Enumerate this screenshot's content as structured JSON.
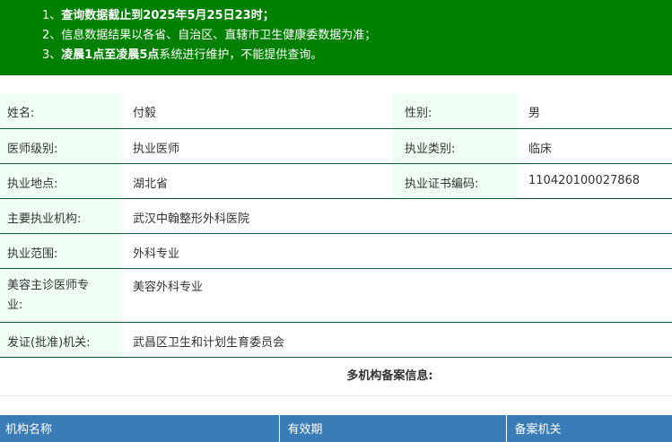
{
  "notice": {
    "line1_prefix": "1、",
    "line1_bold": "查询数据截止到2025年5月25日23时；",
    "line2": "2、信息数据结果以各省、自治区、直辖市卫生健康委数据为准；",
    "line3_prefix": "3、",
    "line3_bold": "凌晨1点至凌晨5点",
    "line3_suffix": "系统进行维护，不能提供查询。"
  },
  "info": {
    "name_label": "姓名:",
    "name_value": "付毅",
    "gender_label": "性别:",
    "gender_value": "男",
    "level_label": "医师级别:",
    "level_value": "执业医师",
    "category_label": "执业类别:",
    "category_value": "临床",
    "location_label": "执业地点:",
    "location_value": "湖北省",
    "cert_label": "执业证书编码:",
    "cert_value": "110420100027868",
    "org_label": "主要执业机构:",
    "org_value": "武汉中翰整形外科医院",
    "scope_label": "执业范围:",
    "scope_value": "外科专业",
    "cosmetic_label": "美容主诊医师专业:",
    "cosmetic_value": "美容外科专业",
    "issuer_label": "发证(批准)机关:",
    "issuer_value": "武昌区卫生和计划生育委员会"
  },
  "multi": {
    "title": "多机构备案信息:",
    "headers": [
      "机构名称",
      "有效期",
      "备案机关"
    ]
  }
}
